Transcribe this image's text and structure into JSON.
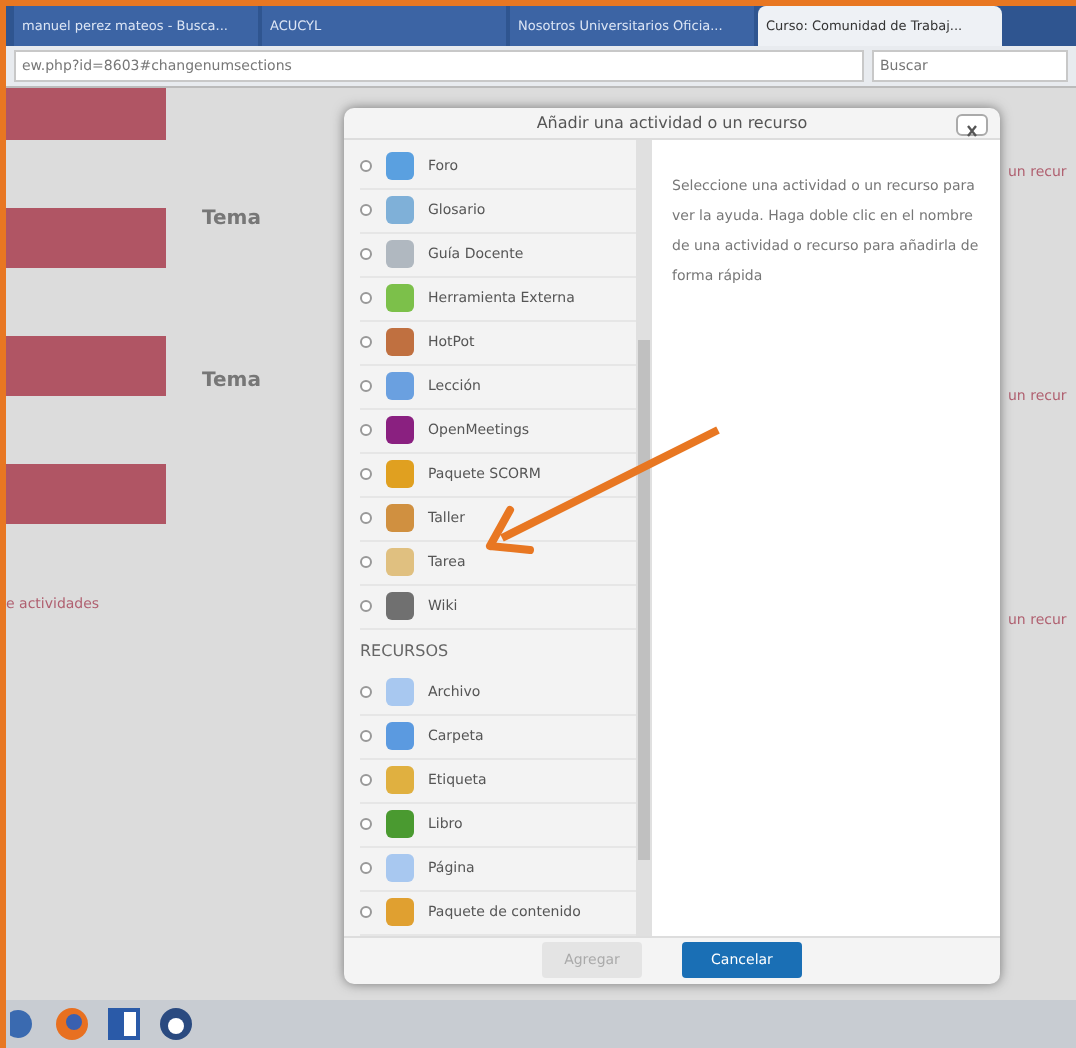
{
  "browser": {
    "tabs": [
      {
        "label": "manuel perez mateos - Busca...",
        "selected": false
      },
      {
        "label": "ACUCYL",
        "selected": false
      },
      {
        "label": "Nosotros Universitarios Oficia...",
        "selected": false
      },
      {
        "label": "Curso: Comunidad de Trabaj...",
        "selected": true
      }
    ],
    "address": "ew.php?id=8603#changenumsections",
    "search": {
      "placeholder": "Buscar"
    }
  },
  "page": {
    "left_link": "e actividades",
    "sections": [
      {
        "title": "Tema"
      },
      {
        "title": "Tema"
      }
    ],
    "right_links": [
      "un recur",
      "un recur",
      "un recur"
    ]
  },
  "dialog": {
    "title": "Añadir una actividad o un recurso",
    "items": [
      {
        "kind": "option",
        "label": "Foro",
        "selected": false
      },
      {
        "kind": "option",
        "label": "Glosario",
        "selected": false
      },
      {
        "kind": "option",
        "label": "Guía Docente",
        "selected": false
      },
      {
        "kind": "option",
        "label": "Herramienta Externa",
        "selected": false
      },
      {
        "kind": "option",
        "label": "HotPot",
        "selected": false
      },
      {
        "kind": "option",
        "label": "Lección",
        "selected": false
      },
      {
        "kind": "option",
        "label": "OpenMeetings",
        "selected": false
      },
      {
        "kind": "option",
        "label": "Paquete SCORM",
        "selected": false
      },
      {
        "kind": "option",
        "label": "Taller",
        "selected": false
      },
      {
        "kind": "option",
        "label": "Tarea",
        "selected": false
      },
      {
        "kind": "option",
        "label": "Wiki",
        "selected": false
      },
      {
        "kind": "heading",
        "label": "RECURSOS"
      },
      {
        "kind": "option",
        "label": "Archivo",
        "selected": false
      },
      {
        "kind": "option",
        "label": "Carpeta",
        "selected": false
      },
      {
        "kind": "option",
        "label": "Etiqueta",
        "selected": false
      },
      {
        "kind": "option",
        "label": "Libro",
        "selected": false
      },
      {
        "kind": "option",
        "label": "Página",
        "selected": false
      },
      {
        "kind": "option",
        "label": "Paquete de contenido",
        "selected": false
      }
    ],
    "help": "Seleccione una actividad o un recurso para ver la ayuda. Haga doble clic en el nombre de una actividad o recurso para añadirla de forma rápida",
    "buttons": [
      {
        "label": "Agregar",
        "disabled": true
      },
      {
        "label": "Cancelar",
        "disabled": false
      }
    ]
  }
}
